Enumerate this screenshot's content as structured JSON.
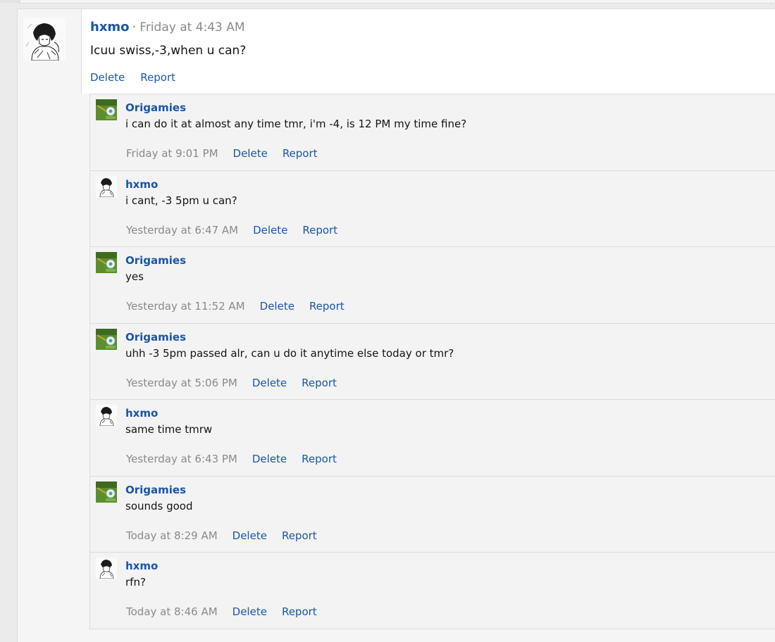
{
  "colors": {
    "link": "#1a56a8",
    "muted": "#8a8a8a",
    "text": "#141414",
    "panel": "#f3f3f3",
    "border": "#dcdcdc"
  },
  "post": {
    "author": "hxmo",
    "separator": "·",
    "time": "Friday at 4:43 AM",
    "text": "Icuu swiss,-3,when u can?",
    "avatar_icon": "manga-sketch-avatar",
    "actions": {
      "delete": "Delete",
      "report": "Report"
    }
  },
  "comments": [
    {
      "author": "Origamies",
      "avatar": "origamies",
      "text": "i can do it at almost any time tmr, i'm -4, is 12 PM my time fine?",
      "time": "Friday at 9:01 PM",
      "delete": "Delete",
      "report": "Report"
    },
    {
      "author": "hxmo",
      "avatar": "hxmo",
      "text": "i cant, -3 5pm u can?",
      "time": "Yesterday at 6:47 AM",
      "delete": "Delete",
      "report": "Report"
    },
    {
      "author": "Origamies",
      "avatar": "origamies",
      "text": "yes",
      "time": "Yesterday at 11:52 AM",
      "delete": "Delete",
      "report": "Report"
    },
    {
      "author": "Origamies",
      "avatar": "origamies",
      "text": "uhh -3 5pm passed alr, can u do it anytime else today or tmr?",
      "time": "Yesterday at 5:06 PM",
      "delete": "Delete",
      "report": "Report"
    },
    {
      "author": "hxmo",
      "avatar": "hxmo",
      "text": "same time tmrw",
      "time": "Yesterday at 6:43 PM",
      "delete": "Delete",
      "report": "Report"
    },
    {
      "author": "Origamies",
      "avatar": "origamies",
      "text": "sounds good",
      "time": "Today at 8:29 AM",
      "delete": "Delete",
      "report": "Report"
    },
    {
      "author": "hxmo",
      "avatar": "hxmo",
      "text": "rfn?",
      "time": "Today at 8:46 AM",
      "delete": "Delete",
      "report": "Report"
    }
  ]
}
